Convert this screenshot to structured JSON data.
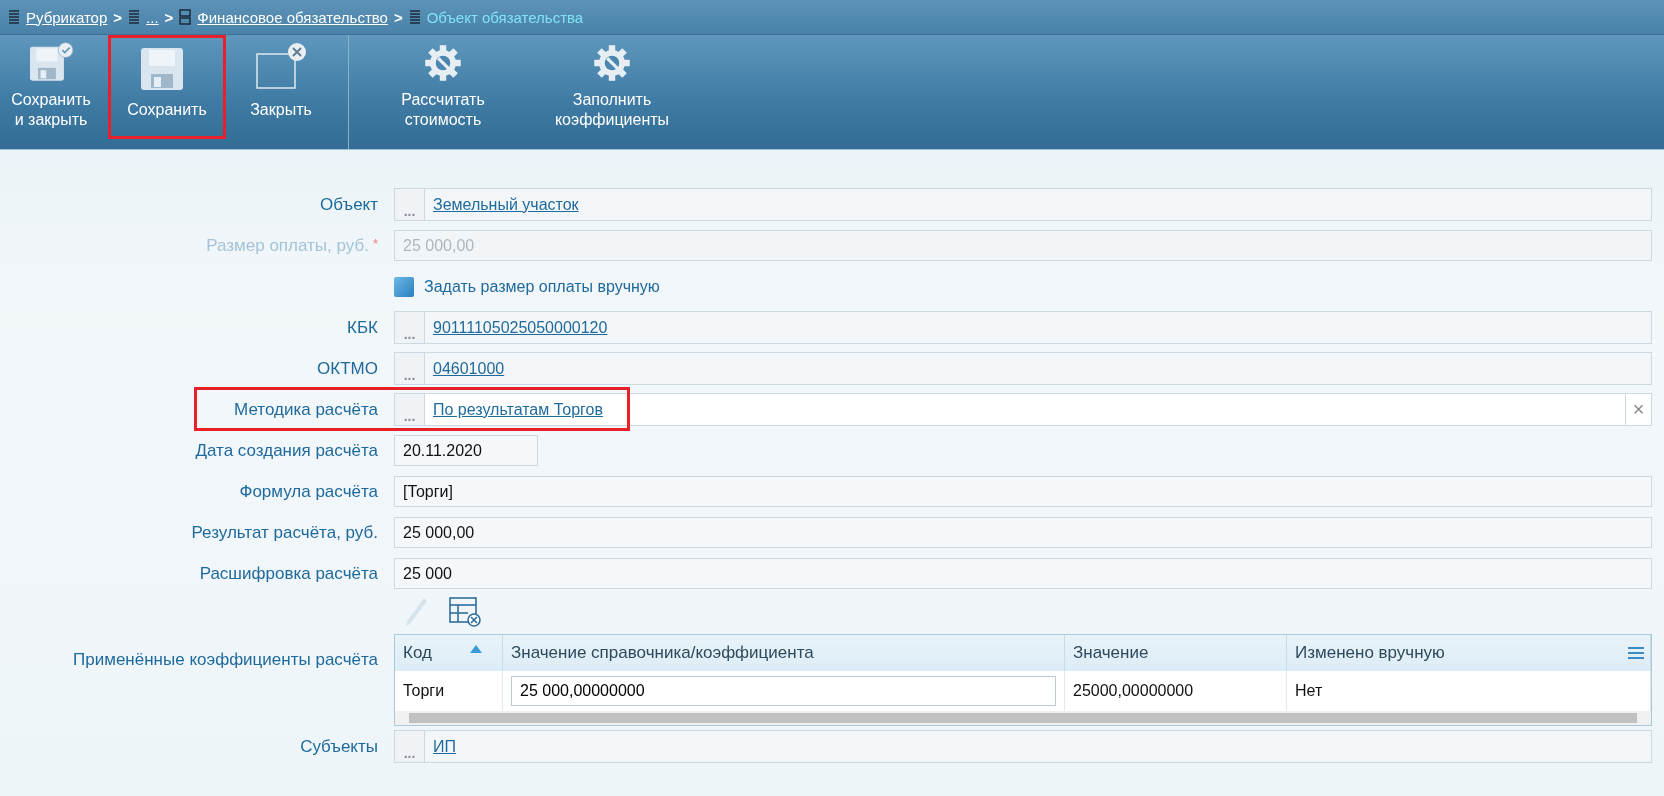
{
  "breadcrumb": [
    {
      "label": "Рубрикатор",
      "current": false,
      "separator": ">"
    },
    {
      "label": "...",
      "current": false,
      "separator": ">"
    },
    {
      "label": "Финансовое обязательство",
      "current": false,
      "separator": ">"
    },
    {
      "label": "Объект обязательства",
      "current": true
    }
  ],
  "toolbar": [
    {
      "label": "Сохранить и закрыть",
      "highlighted": false
    },
    {
      "label": "Сохранить",
      "highlighted": true
    },
    {
      "label": "Закрыть",
      "highlighted": false
    },
    {
      "label": "Рассчитать стоимость",
      "highlighted": false
    },
    {
      "label": "Заполнить коэффициенты",
      "highlighted": false
    }
  ],
  "form": [
    {
      "kind": "lookup",
      "label": "Объект",
      "button": "...",
      "value": "Земельный участок",
      "highlighted": false
    },
    {
      "kind": "text",
      "label": "Размер оплаты, руб.",
      "required_mark": "*",
      "value": "25 000,00",
      "disabled": true
    },
    {
      "kind": "checkbox",
      "label": "Задать размер оплаты вручную",
      "checked": false
    },
    {
      "kind": "lookup",
      "label": "КБК",
      "button": "...",
      "value": "90111105025050000120",
      "highlighted": false
    },
    {
      "kind": "lookup",
      "label": "ОКТМО",
      "button": "...",
      "value": "04601000",
      "highlighted": false
    },
    {
      "kind": "lookup",
      "label": "Методика расчёта",
      "button": "...",
      "value": "По результатам Торгов",
      "highlighted": true,
      "clear": "×"
    },
    {
      "kind": "date",
      "label": "Дата создания расчёта",
      "value": "20.11.2020",
      "disabled": false
    },
    {
      "kind": "text",
      "label": "Формула расчёта",
      "value": "[Торги]",
      "disabled": false
    },
    {
      "kind": "text",
      "label": "Результат расчёта, руб.",
      "value": "25 000,00",
      "disabled": false
    },
    {
      "kind": "text",
      "label": "Расшифровка расчёта",
      "value": "25 000",
      "disabled": false
    },
    {
      "kind": "table",
      "label": "Применённые коэффициенты расчёта",
      "edit_disabled": true,
      "columns": [
        {
          "title": "Код",
          "sorted": true
        },
        {
          "title": "Значение справочника/коэффициента",
          "sorted": false
        },
        {
          "title": "Значение",
          "sorted": false
        },
        {
          "title": "Изменено вручную",
          "sorted": false
        }
      ],
      "rows": [
        {
          "code": "Торги",
          "input": "25 000,00000000",
          "value": "25000,00000000",
          "manual": "Нет"
        }
      ]
    },
    {
      "kind": "lookup",
      "label": "Субъекты",
      "button": "...",
      "value": "ИП",
      "highlighted": false
    }
  ]
}
